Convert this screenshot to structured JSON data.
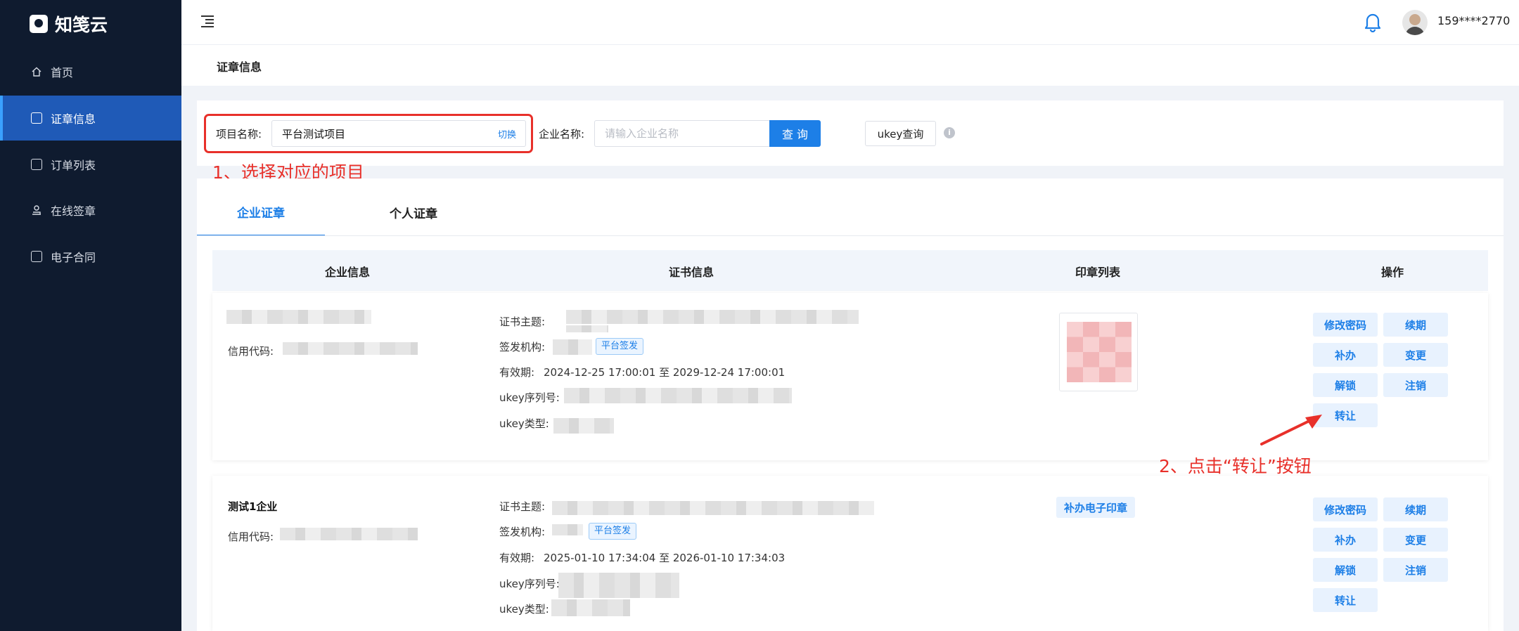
{
  "brand": {
    "name": "知笺云"
  },
  "sidebar": {
    "items": [
      {
        "label": "首页",
        "icon": "home-icon",
        "active": false
      },
      {
        "label": "证章信息",
        "icon": "certificate-icon",
        "active": true
      },
      {
        "label": "订单列表",
        "icon": "order-list-icon",
        "active": false
      },
      {
        "label": "在线签章",
        "icon": "stamp-icon",
        "active": false
      },
      {
        "label": "电子合同",
        "icon": "contract-icon",
        "active": false
      }
    ]
  },
  "header": {
    "username": "159****2770"
  },
  "page": {
    "title": "证章信息"
  },
  "filters": {
    "project_label": "项目名称:",
    "project_value": "平台测试项目",
    "switch_label": "切换",
    "company_label": "企业名称:",
    "company_placeholder": "请输入企业名称",
    "query_button": "查 询",
    "ukey_button": "ukey查询"
  },
  "annotations": {
    "step1": "1、选择对应的项目",
    "step2": "2、点击“转让”按钮"
  },
  "tabs": [
    {
      "label": "企业证章",
      "active": true
    },
    {
      "label": "个人证章",
      "active": false
    }
  ],
  "table": {
    "headers": [
      "企业信息",
      "证书信息",
      "印章列表",
      "操作"
    ],
    "rows": [
      {
        "company_name": "",
        "credit_label": "信用代码:",
        "subject_label": "证书主题:",
        "issuer_label": "签发机构:",
        "issuer_tag": "平台签发",
        "validity_label": "有效期:",
        "validity_value": "2024-12-25 17:00:01 至 2029-12-24 17:00:01",
        "serial_label": "ukey序列号:",
        "type_label": "ukey类型:",
        "seal": "seal-image",
        "actions": [
          "修改密码",
          "续期",
          "补办",
          "变更",
          "解锁",
          "注销",
          "转让"
        ]
      },
      {
        "company_name": "测试1企业",
        "credit_label": "信用代码:",
        "subject_label": "证书主题:",
        "issuer_label": "签发机构:",
        "issuer_tag": "平台签发",
        "validity_label": "有效期:",
        "validity_value": "2025-01-10 17:34:04 至 2026-01-10 17:34:03",
        "serial_label": "ukey序列号:",
        "type_label": "ukey类型:",
        "seal_button": "补办电子印章",
        "actions": [
          "修改密码",
          "续期",
          "补办",
          "变更",
          "解锁",
          "注销",
          "转让"
        ]
      }
    ]
  },
  "colors": {
    "sidebar_bg": "#0f1b2f",
    "active_nav": "#1f5ab7",
    "primary": "#1d7fe7",
    "annotation_red": "#e8302a"
  }
}
